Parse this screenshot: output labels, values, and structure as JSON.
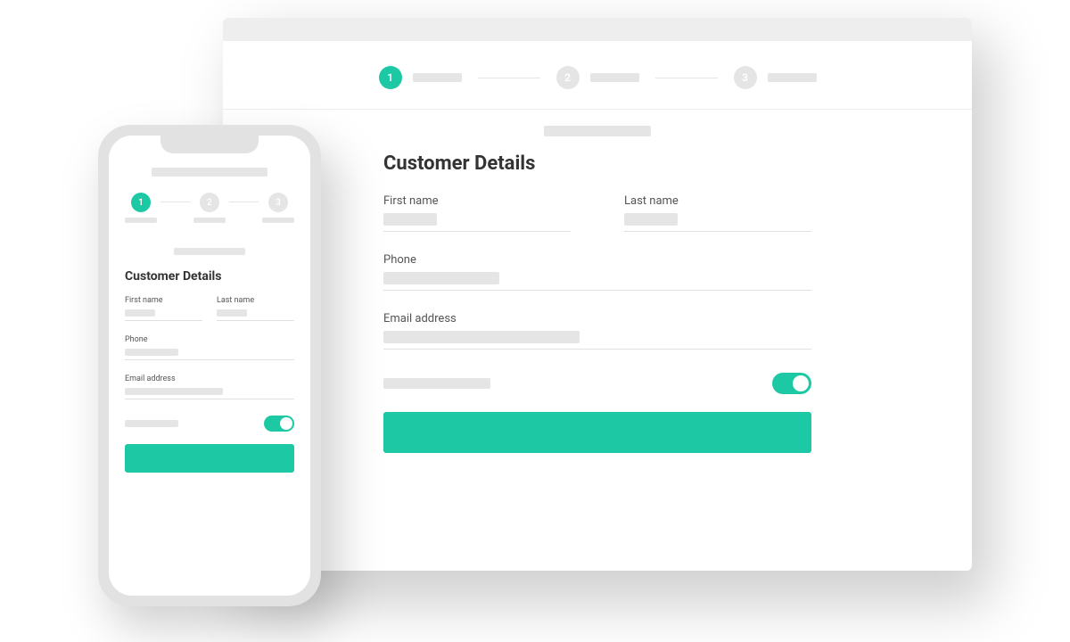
{
  "colors": {
    "accent": "#1dc9a4",
    "placeholder": "#e5e5e5"
  },
  "stepper": {
    "steps": [
      {
        "num": "1",
        "active": true
      },
      {
        "num": "2",
        "active": false
      },
      {
        "num": "3",
        "active": false
      }
    ]
  },
  "form": {
    "section_title": "Customer Details",
    "first_name_label": "First name",
    "last_name_label": "Last name",
    "phone_label": "Phone",
    "email_label": "Email address",
    "toggle_on": true
  }
}
